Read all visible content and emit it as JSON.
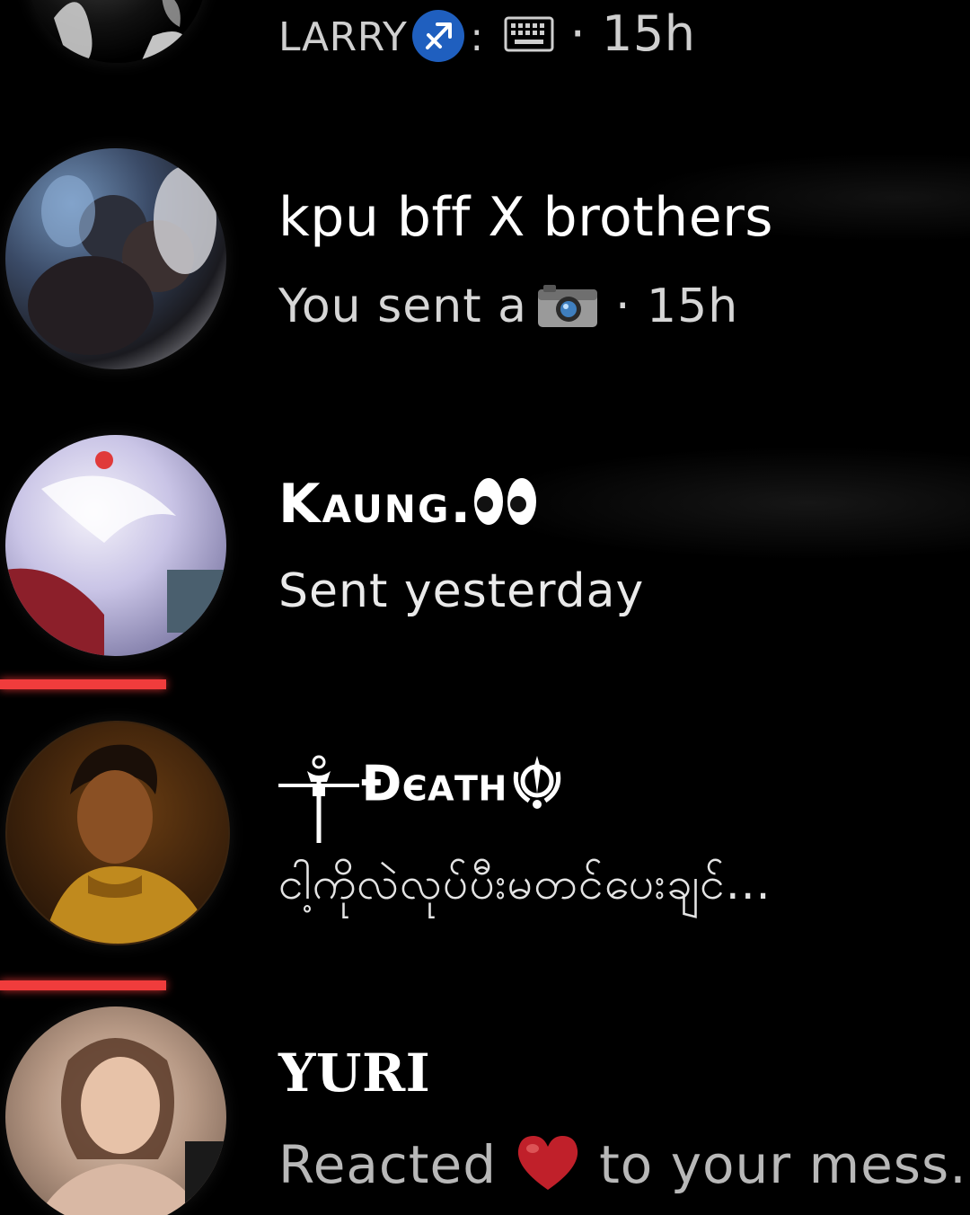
{
  "conversations": [
    {
      "name": "LARRY",
      "separator": ":",
      "time": "· 15h"
    },
    {
      "name": "kpu bff X brothers",
      "message": "You sent a",
      "time": "· 15h"
    },
    {
      "name": "Kaung.",
      "message": "Sent yesterday"
    },
    {
      "name": "Đєαтн",
      "message": "ငါ့ကိုလဲလုပ်ပီးမတင်ပေးချင်..."
    },
    {
      "name": "YURI",
      "message_before": "Reacted",
      "message_after": "to your mess..."
    }
  ],
  "colors": {
    "background": "#000000",
    "unread_indicator": "#f03c3c",
    "name_text": "#ffffff",
    "preview_text": "#d6d6d6",
    "sagittarius_badge": "#1f5fbf",
    "heart": "#c0202a"
  },
  "icons": [
    "sagittarius-icon",
    "keyboard-icon",
    "camera-icon",
    "eyes-icon",
    "dagger-symbol-icon",
    "khanda-icon",
    "heart-icon"
  ]
}
